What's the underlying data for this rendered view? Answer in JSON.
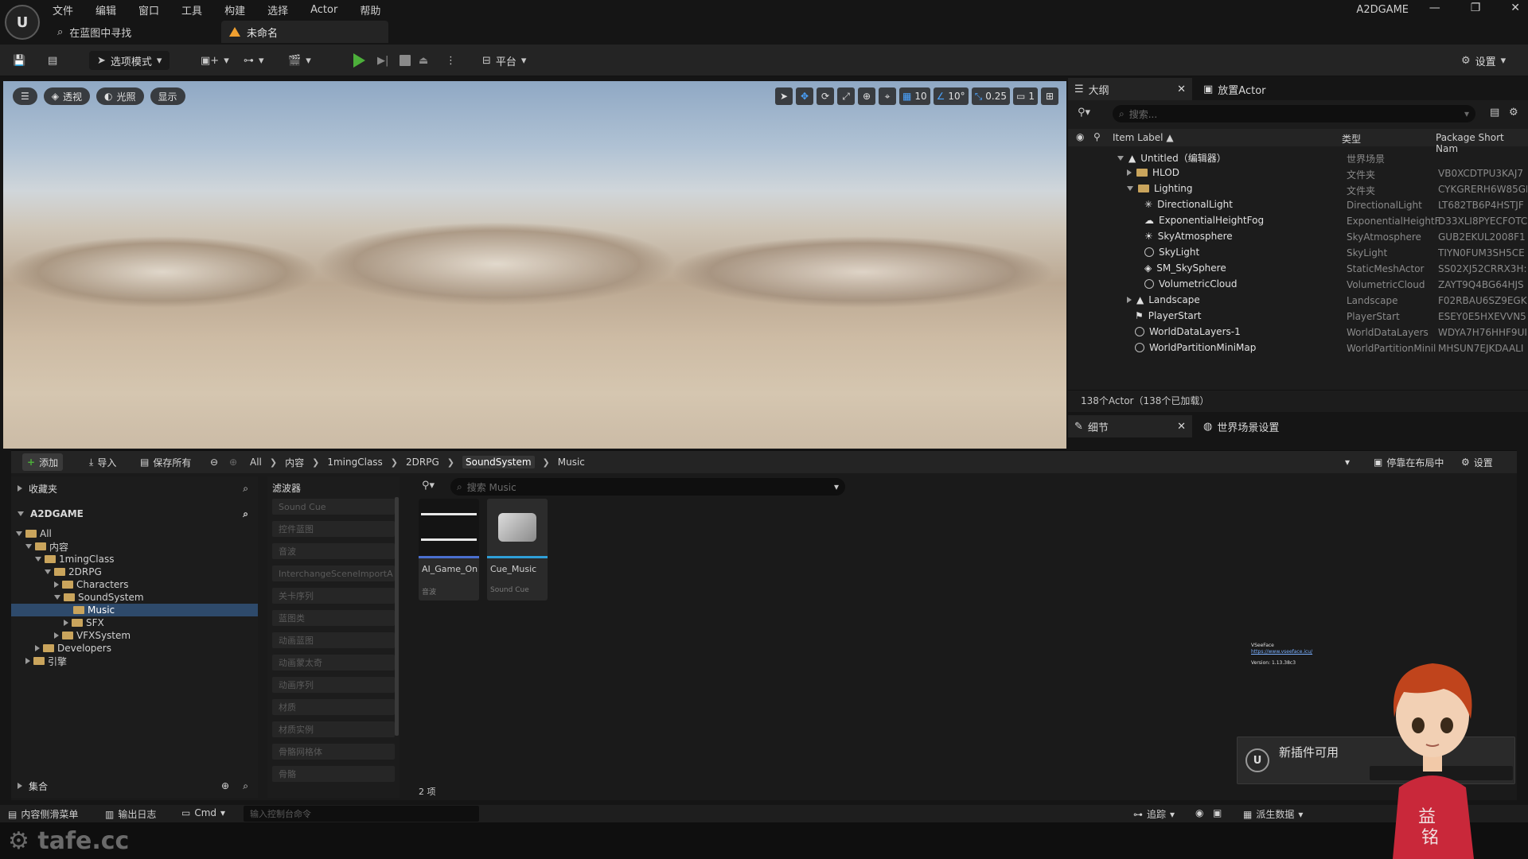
{
  "menu": [
    "文件",
    "编辑",
    "窗口",
    "工具",
    "构建",
    "选择",
    "Actor",
    "帮助"
  ],
  "app_name": "A2DGAME",
  "find_in_blueprint": "在蓝图中寻找",
  "doc_tab": "未命名",
  "toolbar": {
    "mode": "选项模式",
    "platform": "平台",
    "settings": "设置"
  },
  "viewport": {
    "perspective": "透视",
    "lighting": "光照",
    "show": "显示",
    "grid_snap": "10",
    "rot_snap": "10°",
    "scale_snap": "0.25",
    "camera_speed": "1"
  },
  "outliner": {
    "tab": "大纲",
    "place_actor_tab": "放置Actor",
    "search_placeholder": "搜索...",
    "col_label": "Item Label ▲",
    "col_type": "类型",
    "col_pkg": "Package Short Nam",
    "rows": [
      {
        "label": "Untitled（编辑器）",
        "type": "世界场景",
        "pkg": ""
      },
      {
        "label": "HLOD",
        "type": "文件夹",
        "pkg": "VB0XCDTPU3KAJ7"
      },
      {
        "label": "Lighting",
        "type": "文件夹",
        "pkg": "CYKGRERH6W85GI"
      },
      {
        "label": "DirectionalLight",
        "type": "DirectionalLight",
        "pkg": "LT682TB6P4HSTJF"
      },
      {
        "label": "ExponentialHeightFog",
        "type": "ExponentialHeightF",
        "pkg": "D33XLI8PYECFOTC"
      },
      {
        "label": "SkyAtmosphere",
        "type": "SkyAtmosphere",
        "pkg": "GUB2EKUL2008F1"
      },
      {
        "label": "SkyLight",
        "type": "SkyLight",
        "pkg": "TIYN0FUM3SH5CE"
      },
      {
        "label": "SM_SkySphere",
        "type": "StaticMeshActor",
        "pkg": "SS02XJ52CRRX3H:"
      },
      {
        "label": "VolumetricCloud",
        "type": "VolumetricCloud",
        "pkg": "ZAYT9Q4BG64HJS"
      },
      {
        "label": "Landscape",
        "type": "Landscape",
        "pkg": "F02RBAU6SZ9EGK"
      },
      {
        "label": "PlayerStart",
        "type": "PlayerStart",
        "pkg": "ESEY0E5HXEVVN5I"
      },
      {
        "label": "WorldDataLayers-1",
        "type": "WorldDataLayers",
        "pkg": "WDYA7H76HHF9UI"
      },
      {
        "label": "WorldPartitionMiniMap",
        "type": "WorldPartitionMinil",
        "pkg": "MHSUN7EJKDAALI"
      }
    ],
    "count": "138个Actor（138个已加载）"
  },
  "details": {
    "tab": "细节",
    "world_settings_tab": "世界场景设置"
  },
  "content_browser": {
    "add": "添加",
    "import": "导入",
    "save_all": "保存所有",
    "breadcrumbs": [
      "All",
      "内容",
      "1mingClass",
      "2DRPG",
      "SoundSystem",
      "Music"
    ],
    "dock": "停靠在布局中",
    "settings": "设置",
    "favorites": "收藏夹",
    "project": "A2DGAME",
    "collections": "集合",
    "filters_label": "滤波器",
    "filters": [
      "Sound Cue",
      "控件蓝图",
      "音波",
      "InterchangeSceneImportA",
      "关卡序列",
      "蓝图类",
      "动画蓝图",
      "动画蒙太奇",
      "动画序列",
      "材质",
      "材质实例",
      "骨骼网格体",
      "骨骼"
    ],
    "search_placeholder": "搜索 Music",
    "tree": [
      {
        "label": "All",
        "depth": 0
      },
      {
        "label": "内容",
        "depth": 1
      },
      {
        "label": "1mingClass",
        "depth": 2
      },
      {
        "label": "2DRPG",
        "depth": 3
      },
      {
        "label": "Characters",
        "depth": 4
      },
      {
        "label": "SoundSystem",
        "depth": 4
      },
      {
        "label": "Music",
        "depth": 5
      },
      {
        "label": "SFX",
        "depth": 5
      },
      {
        "label": "VFXSystem",
        "depth": 4
      },
      {
        "label": "Developers",
        "depth": 2
      },
      {
        "label": "引擎",
        "depth": 1
      }
    ],
    "assets": [
      {
        "name": "AI_Game_On",
        "type": "音波"
      },
      {
        "name": "Cue_Music",
        "type": "Sound Cue"
      }
    ],
    "item_count": "2 项"
  },
  "statusbar": {
    "content_drawer": "内容侧滑菜单",
    "output_log": "输出日志",
    "cmd": "Cmd",
    "console_placeholder": "输入控制台命令",
    "trace": "追踪",
    "derived_data": "派生数据"
  },
  "notification": {
    "text": "新插件可用"
  },
  "overlay": {
    "watermark": "tafe.cc",
    "vseeface": "VSeeFace",
    "vseeface_url": "https://www.vseeface.icu/",
    "vseeface_version": "Version: 1.13.38c3"
  }
}
